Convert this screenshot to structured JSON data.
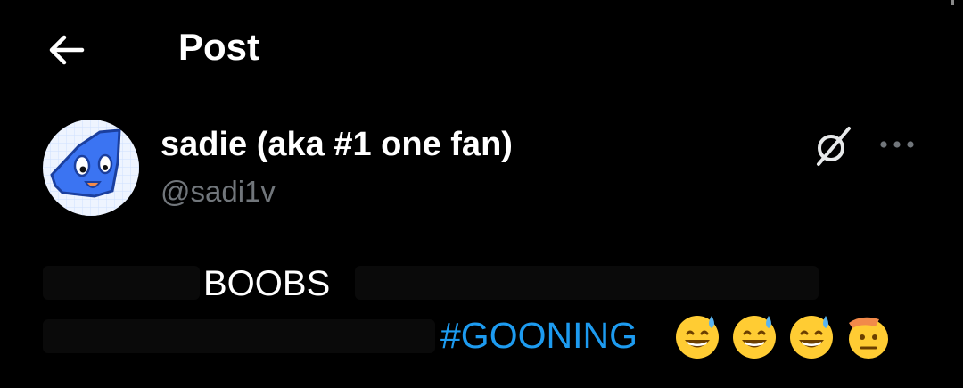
{
  "header": {
    "title": "Post",
    "back_icon": "arrow-left-icon"
  },
  "author": {
    "display_name": "sadie (aka #1 one fan)",
    "handle": "@sadi1v",
    "avatar_icon": "blue-cartoon-avatar",
    "grok_icon": "grok-slash-icon",
    "more_icon": "more-horizontal-icon"
  },
  "post": {
    "visible_word": "BOOBS",
    "hashtag": "#GOONING",
    "emojis": [
      "grinning-sweat-emoji",
      "grinning-sweat-emoji",
      "grinning-sweat-emoji",
      "saluting-face-emoji"
    ]
  },
  "colors": {
    "background": "#000000",
    "hashtag": "#1d9bf0",
    "handle": "#71767b",
    "text": "#ffffff"
  }
}
